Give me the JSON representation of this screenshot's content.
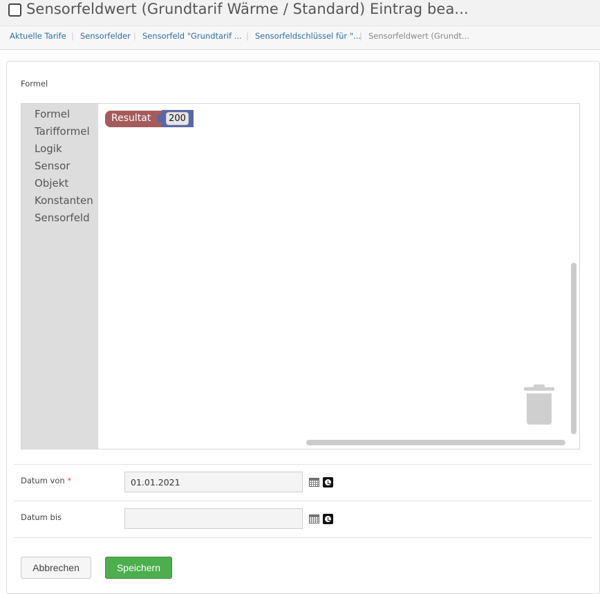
{
  "header": {
    "title": "Sensorfeldwert (Grundtarif Wärme / Standard) Eintrag bea..."
  },
  "breadcrumb": {
    "items": [
      {
        "label": "Aktuelle Tarife"
      },
      {
        "label": "Sensorfelder"
      },
      {
        "label": "Sensorfeld \"Grundtarif ..."
      },
      {
        "label": "Sensorfeldschlüssel für \"..."
      },
      {
        "label": "Sensorfeldwert (Grundt..."
      }
    ],
    "separator": "|"
  },
  "form": {
    "formel_label": "Formel",
    "toolbox": {
      "categories": [
        "Formel",
        "Tarifformel",
        "Logik",
        "Sensor",
        "Objekt",
        "Konstanten",
        "Sensorfeld"
      ]
    },
    "blocks": {
      "result_label": "Resultat",
      "number_value": "200",
      "result_color": "#a55b5b",
      "number_color": "#5b67a5"
    },
    "datum_von": {
      "label": "Datum von",
      "required_marker": "*",
      "value": "01.01.2021"
    },
    "datum_bis": {
      "label": "Datum bis",
      "value": ""
    }
  },
  "actions": {
    "cancel_label": "Abbrechen",
    "save_label": "Speichern",
    "save_color": "#4cae4c"
  },
  "icons": [
    "checkbox-icon",
    "calendar-icon",
    "clock-icon",
    "trash-icon"
  ]
}
